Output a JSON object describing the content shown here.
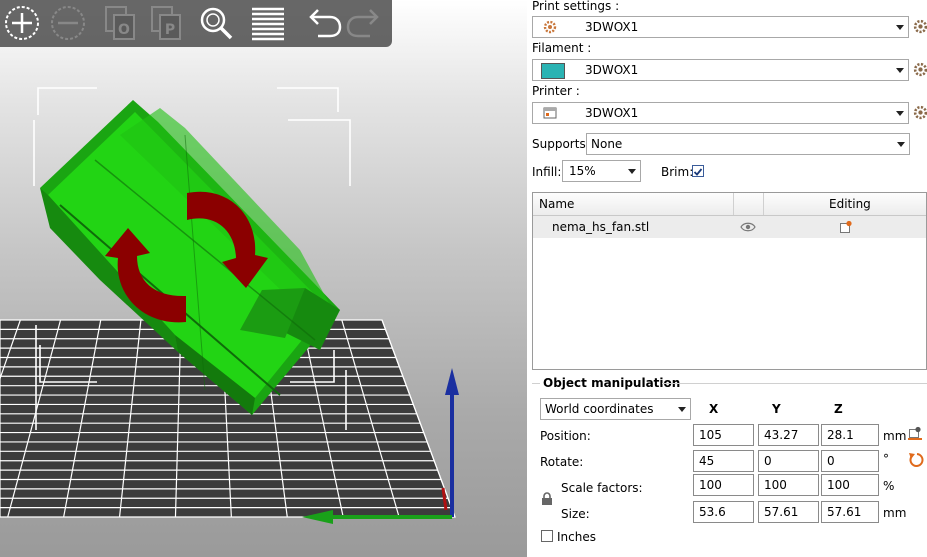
{
  "toolbar": {
    "buttons": [
      {
        "name": "add-icon",
        "enabled": true
      },
      {
        "name": "remove-icon",
        "enabled": false
      },
      {
        "name": "copy-object-icon",
        "enabled": false
      },
      {
        "name": "paste-object-icon",
        "enabled": false
      },
      {
        "name": "search-icon",
        "enabled": true
      },
      {
        "name": "layers-icon",
        "enabled": true
      },
      {
        "name": "undo-icon",
        "enabled": true
      },
      {
        "name": "redo-icon",
        "enabled": false
      }
    ]
  },
  "colors": {
    "model": "#22cc11",
    "arrow": "#8b0000",
    "filament": "#2ab3b3",
    "axis_z": "#1a2fa0",
    "axis_y": "#19a019",
    "accent": "#e06a1b"
  },
  "settings": {
    "print_label": "Print settings :",
    "print_value": "3DWOX1",
    "filament_label": "Filament :",
    "filament_value": "3DWOX1",
    "printer_label": "Printer :",
    "printer_value": "3DWOX1",
    "supports_label": "Supports:",
    "supports_value": "None",
    "infill_label": "Infill:",
    "infill_value": "15%",
    "brim_label": "Brim:",
    "brim_checked": true
  },
  "object_list": {
    "col_name": "Name",
    "col_editing": "Editing",
    "rows": [
      {
        "name": "nema_hs_fan.stl"
      }
    ]
  },
  "manipulation": {
    "title": "Object manipulation",
    "coord_mode": "World coordinates",
    "axes": [
      "X",
      "Y",
      "Z"
    ],
    "position_label": "Position:",
    "position": [
      "105",
      "43.27",
      "28.1"
    ],
    "position_unit": "mm",
    "rotate_label": "Rotate:",
    "rotate": [
      "45",
      "0",
      "0"
    ],
    "rotate_unit": "°",
    "scale_label": "Scale factors:",
    "scale": [
      "100",
      "100",
      "100"
    ],
    "scale_unit": "%",
    "size_label": "Size:",
    "size": [
      "53.6",
      "57.61",
      "57.61"
    ],
    "size_unit": "mm",
    "inches_label": "Inches",
    "inches_checked": false
  }
}
